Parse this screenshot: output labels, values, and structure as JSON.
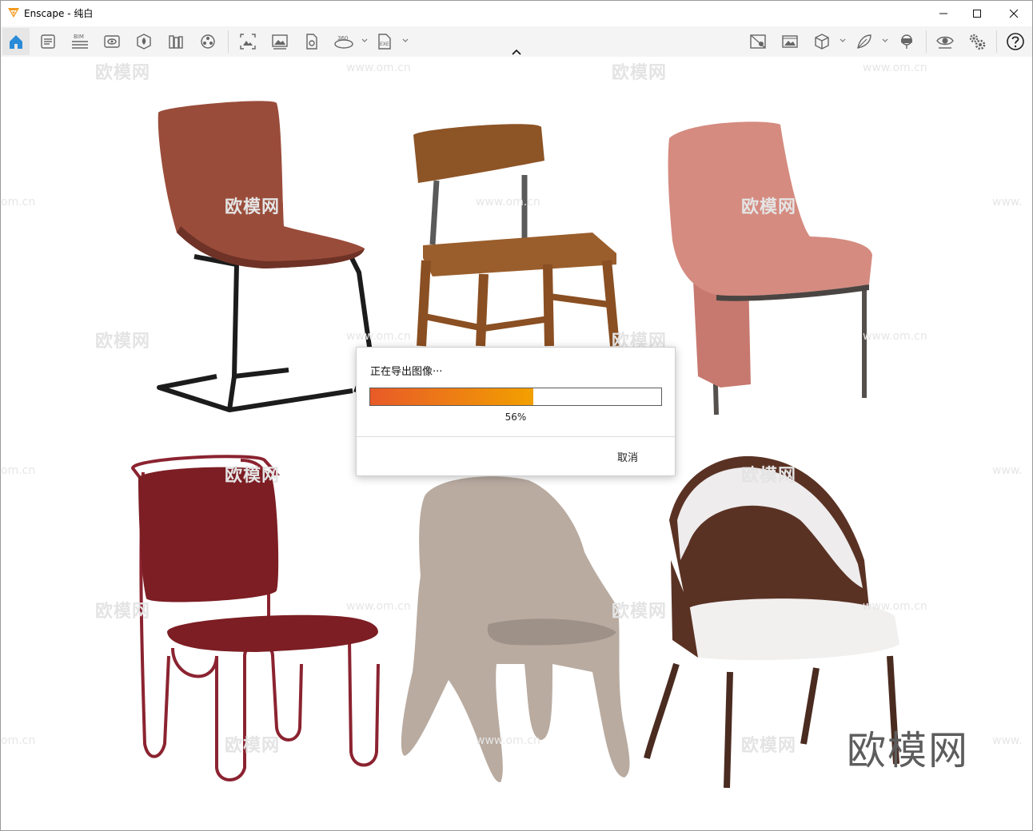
{
  "window": {
    "app_name": "Enscape",
    "title": "Enscape - 纯白",
    "accent": "#f39a1e"
  },
  "toolbar": {
    "icons": [
      "home-icon",
      "document-icon",
      "bim-icon",
      "visual-settings-icon",
      "asset-library-icon",
      "libraries-icon",
      "materials-icon",
      "screenshot-icon",
      "batch-render-icon",
      "panorama-icon",
      "360-view-icon",
      "exe-export-icon",
      "mini-map-icon",
      "image-gallery-icon",
      "object-icon",
      "material-editor-icon",
      "vr-headset-icon",
      "eye-icon",
      "settings-icon",
      "help-icon"
    ],
    "bim_label": "BIM",
    "pano_label": "360",
    "exe_label": "EXE"
  },
  "watermarks": {
    "site": "www.om.cn",
    "site_trunc_left": "om.cn",
    "site_trunc_right": "www.",
    "brand": "欧模网",
    "big_brand": "欧模网"
  },
  "dialog": {
    "title": "正在导出图像···",
    "progress_percent": 56,
    "progress_text": "56%",
    "cancel": "取消",
    "fill_from": "#e85a28",
    "fill_to": "#f2a000"
  },
  "scene": {
    "chairs": [
      "brown leather cantilever chair",
      "wooden school chair",
      "pink fabric chair",
      "red upholstered chair with tube frame",
      "grey fabric tub chair",
      "white and walnut arch chair"
    ]
  }
}
